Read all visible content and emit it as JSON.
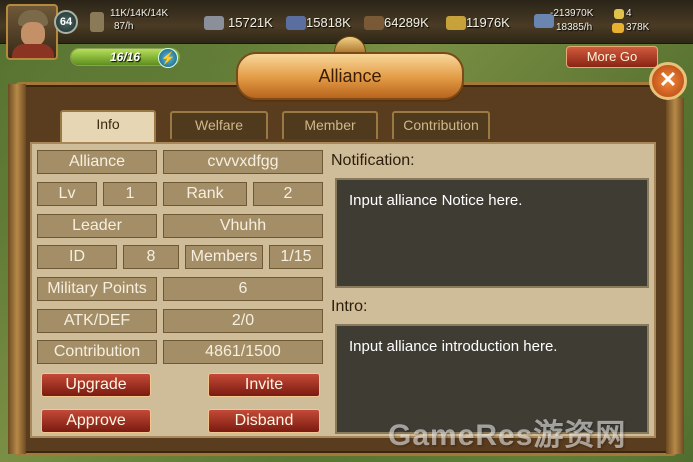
{
  "hud": {
    "level": "64",
    "stats": {
      "troops": "11K/14K/14K",
      "troop_rate": "87/h",
      "resource_1": "15721K",
      "resource_2": "15818K",
      "resource_3": "64289K",
      "resource_4": "11976K",
      "resource_5": "-213970K",
      "resource_5_rate": "18385/h",
      "gems": "4",
      "gold": "378K"
    },
    "energy": "16/16",
    "energy_fraction": 1.0,
    "more_button": "More Go"
  },
  "dialog": {
    "title": "Alliance",
    "close_glyph": "✕"
  },
  "tabs": [
    {
      "label": "Info",
      "active": true
    },
    {
      "label": "Welfare",
      "active": false
    },
    {
      "label": "Member",
      "active": false
    },
    {
      "label": "Contribution",
      "active": false
    }
  ],
  "info": {
    "alliance_label": "Alliance",
    "alliance_value": "cvvvxdfgg",
    "lv_label": "Lv",
    "lv_value": "1",
    "rank_label": "Rank",
    "rank_value": "2",
    "leader_label": "Leader",
    "leader_value": "Vhuhh",
    "id_label": "ID",
    "id_value": "8",
    "members_label": "Members",
    "members_value": "1/15",
    "military_label": "Military Points",
    "military_value": "6",
    "atkdef_label": "ATK/DEF",
    "atkdef_value": "2/0",
    "contribution_label": "Contribution",
    "contribution_value": "4861/1500"
  },
  "actions": {
    "upgrade": "Upgrade",
    "invite": "Invite",
    "approve": "Approve",
    "disband": "Disband"
  },
  "notification": {
    "label": "Notification:",
    "text": "Input alliance Notice here."
  },
  "intro": {
    "label": "Intro:",
    "text": "Input alliance introduction here."
  },
  "watermark": "GameRes游资网"
}
